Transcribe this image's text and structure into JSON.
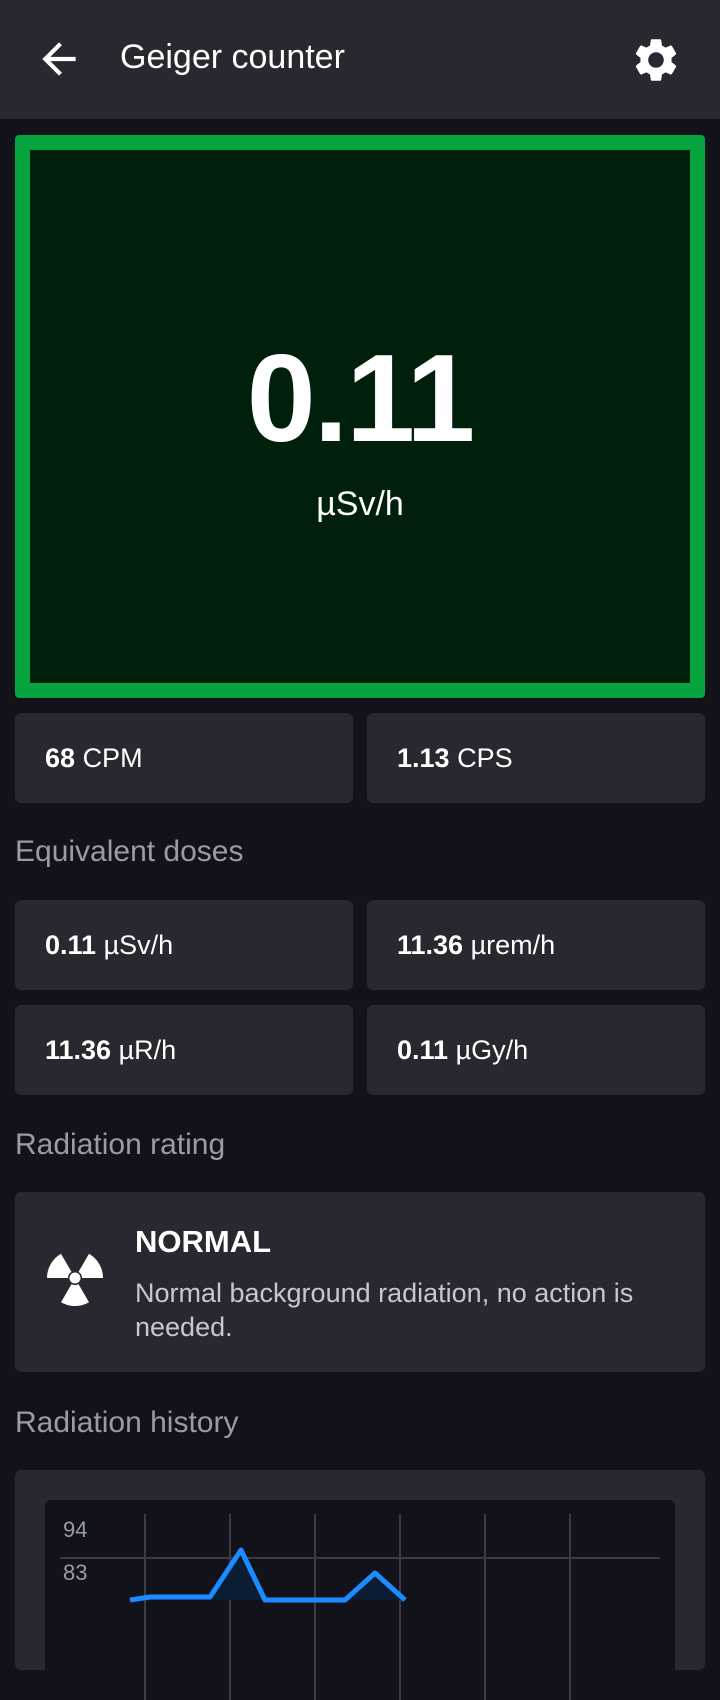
{
  "app_bar": {
    "title": "Geiger counter",
    "back_icon": "arrow-left-icon",
    "settings_icon": "gear-icon"
  },
  "reading": {
    "value": "0.11",
    "unit": "µSv/h",
    "status_color": "#05a43e"
  },
  "counts": [
    {
      "value": "68",
      "unit": "CPM"
    },
    {
      "value": "1.13",
      "unit": "CPS"
    }
  ],
  "equivalent": {
    "title": "Equivalent doses",
    "items": [
      {
        "value": "0.11",
        "unit": "µSv/h"
      },
      {
        "value": "11.36",
        "unit": "µrem/h"
      },
      {
        "value": "11.36",
        "unit": "µR/h"
      },
      {
        "value": "0.11",
        "unit": "µGy/h"
      }
    ]
  },
  "rating": {
    "title": "Radiation rating",
    "level": "NORMAL",
    "description": "Normal background radiation, no action is needed.",
    "icon": "radiation-icon"
  },
  "history": {
    "title": "Radiation history",
    "y_ticks": [
      "94",
      "83"
    ],
    "line_color": "#1a8cff"
  }
}
